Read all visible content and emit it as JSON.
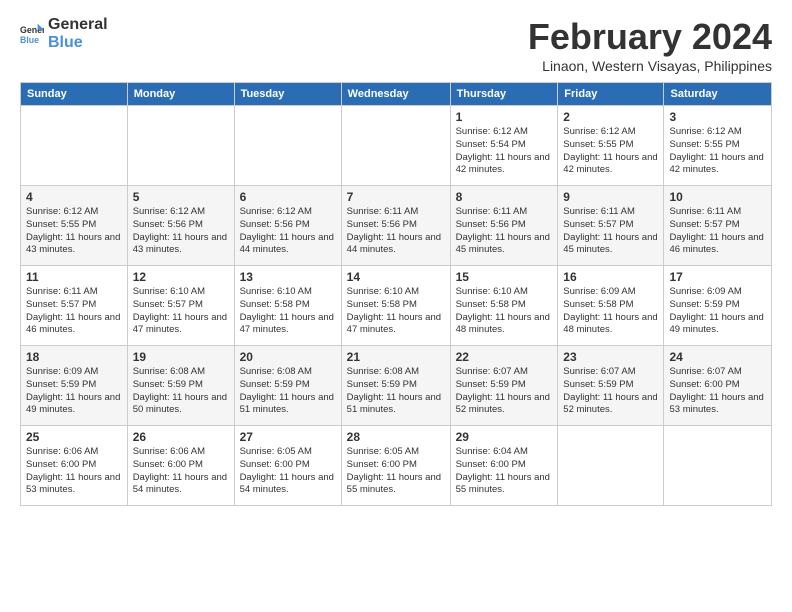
{
  "logo": {
    "text_general": "General",
    "text_blue": "Blue"
  },
  "header": {
    "month_year": "February 2024",
    "location": "Linaon, Western Visayas, Philippines"
  },
  "columns": [
    "Sunday",
    "Monday",
    "Tuesday",
    "Wednesday",
    "Thursday",
    "Friday",
    "Saturday"
  ],
  "weeks": [
    [
      {
        "day": "",
        "sunrise": "",
        "sunset": "",
        "daylight": ""
      },
      {
        "day": "",
        "sunrise": "",
        "sunset": "",
        "daylight": ""
      },
      {
        "day": "",
        "sunrise": "",
        "sunset": "",
        "daylight": ""
      },
      {
        "day": "",
        "sunrise": "",
        "sunset": "",
        "daylight": ""
      },
      {
        "day": "1",
        "sunrise": "Sunrise: 6:12 AM",
        "sunset": "Sunset: 5:54 PM",
        "daylight": "Daylight: 11 hours and 42 minutes."
      },
      {
        "day": "2",
        "sunrise": "Sunrise: 6:12 AM",
        "sunset": "Sunset: 5:55 PM",
        "daylight": "Daylight: 11 hours and 42 minutes."
      },
      {
        "day": "3",
        "sunrise": "Sunrise: 6:12 AM",
        "sunset": "Sunset: 5:55 PM",
        "daylight": "Daylight: 11 hours and 42 minutes."
      }
    ],
    [
      {
        "day": "4",
        "sunrise": "Sunrise: 6:12 AM",
        "sunset": "Sunset: 5:55 PM",
        "daylight": "Daylight: 11 hours and 43 minutes."
      },
      {
        "day": "5",
        "sunrise": "Sunrise: 6:12 AM",
        "sunset": "Sunset: 5:56 PM",
        "daylight": "Daylight: 11 hours and 43 minutes."
      },
      {
        "day": "6",
        "sunrise": "Sunrise: 6:12 AM",
        "sunset": "Sunset: 5:56 PM",
        "daylight": "Daylight: 11 hours and 44 minutes."
      },
      {
        "day": "7",
        "sunrise": "Sunrise: 6:11 AM",
        "sunset": "Sunset: 5:56 PM",
        "daylight": "Daylight: 11 hours and 44 minutes."
      },
      {
        "day": "8",
        "sunrise": "Sunrise: 6:11 AM",
        "sunset": "Sunset: 5:56 PM",
        "daylight": "Daylight: 11 hours and 45 minutes."
      },
      {
        "day": "9",
        "sunrise": "Sunrise: 6:11 AM",
        "sunset": "Sunset: 5:57 PM",
        "daylight": "Daylight: 11 hours and 45 minutes."
      },
      {
        "day": "10",
        "sunrise": "Sunrise: 6:11 AM",
        "sunset": "Sunset: 5:57 PM",
        "daylight": "Daylight: 11 hours and 46 minutes."
      }
    ],
    [
      {
        "day": "11",
        "sunrise": "Sunrise: 6:11 AM",
        "sunset": "Sunset: 5:57 PM",
        "daylight": "Daylight: 11 hours and 46 minutes."
      },
      {
        "day": "12",
        "sunrise": "Sunrise: 6:10 AM",
        "sunset": "Sunset: 5:57 PM",
        "daylight": "Daylight: 11 hours and 47 minutes."
      },
      {
        "day": "13",
        "sunrise": "Sunrise: 6:10 AM",
        "sunset": "Sunset: 5:58 PM",
        "daylight": "Daylight: 11 hours and 47 minutes."
      },
      {
        "day": "14",
        "sunrise": "Sunrise: 6:10 AM",
        "sunset": "Sunset: 5:58 PM",
        "daylight": "Daylight: 11 hours and 47 minutes."
      },
      {
        "day": "15",
        "sunrise": "Sunrise: 6:10 AM",
        "sunset": "Sunset: 5:58 PM",
        "daylight": "Daylight: 11 hours and 48 minutes."
      },
      {
        "day": "16",
        "sunrise": "Sunrise: 6:09 AM",
        "sunset": "Sunset: 5:58 PM",
        "daylight": "Daylight: 11 hours and 48 minutes."
      },
      {
        "day": "17",
        "sunrise": "Sunrise: 6:09 AM",
        "sunset": "Sunset: 5:59 PM",
        "daylight": "Daylight: 11 hours and 49 minutes."
      }
    ],
    [
      {
        "day": "18",
        "sunrise": "Sunrise: 6:09 AM",
        "sunset": "Sunset: 5:59 PM",
        "daylight": "Daylight: 11 hours and 49 minutes."
      },
      {
        "day": "19",
        "sunrise": "Sunrise: 6:08 AM",
        "sunset": "Sunset: 5:59 PM",
        "daylight": "Daylight: 11 hours and 50 minutes."
      },
      {
        "day": "20",
        "sunrise": "Sunrise: 6:08 AM",
        "sunset": "Sunset: 5:59 PM",
        "daylight": "Daylight: 11 hours and 51 minutes."
      },
      {
        "day": "21",
        "sunrise": "Sunrise: 6:08 AM",
        "sunset": "Sunset: 5:59 PM",
        "daylight": "Daylight: 11 hours and 51 minutes."
      },
      {
        "day": "22",
        "sunrise": "Sunrise: 6:07 AM",
        "sunset": "Sunset: 5:59 PM",
        "daylight": "Daylight: 11 hours and 52 minutes."
      },
      {
        "day": "23",
        "sunrise": "Sunrise: 6:07 AM",
        "sunset": "Sunset: 5:59 PM",
        "daylight": "Daylight: 11 hours and 52 minutes."
      },
      {
        "day": "24",
        "sunrise": "Sunrise: 6:07 AM",
        "sunset": "Sunset: 6:00 PM",
        "daylight": "Daylight: 11 hours and 53 minutes."
      }
    ],
    [
      {
        "day": "25",
        "sunrise": "Sunrise: 6:06 AM",
        "sunset": "Sunset: 6:00 PM",
        "daylight": "Daylight: 11 hours and 53 minutes."
      },
      {
        "day": "26",
        "sunrise": "Sunrise: 6:06 AM",
        "sunset": "Sunset: 6:00 PM",
        "daylight": "Daylight: 11 hours and 54 minutes."
      },
      {
        "day": "27",
        "sunrise": "Sunrise: 6:05 AM",
        "sunset": "Sunset: 6:00 PM",
        "daylight": "Daylight: 11 hours and 54 minutes."
      },
      {
        "day": "28",
        "sunrise": "Sunrise: 6:05 AM",
        "sunset": "Sunset: 6:00 PM",
        "daylight": "Daylight: 11 hours and 55 minutes."
      },
      {
        "day": "29",
        "sunrise": "Sunrise: 6:04 AM",
        "sunset": "Sunset: 6:00 PM",
        "daylight": "Daylight: 11 hours and 55 minutes."
      },
      {
        "day": "",
        "sunrise": "",
        "sunset": "",
        "daylight": ""
      },
      {
        "day": "",
        "sunrise": "",
        "sunset": "",
        "daylight": ""
      }
    ]
  ]
}
